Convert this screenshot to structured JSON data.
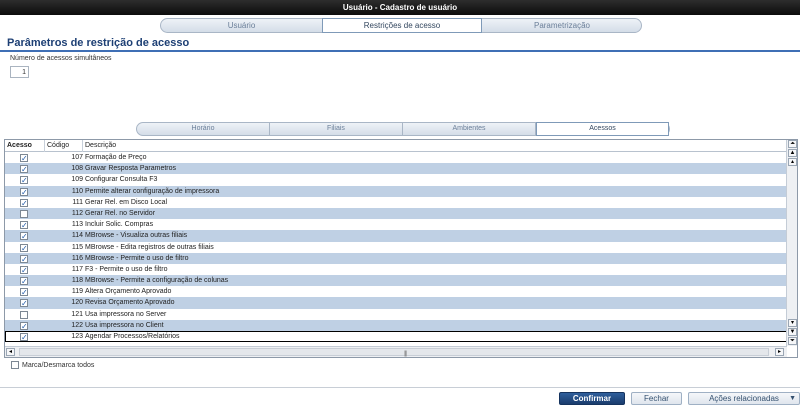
{
  "window": {
    "title": "Usuário - Cadastro de usuário"
  },
  "top_tabs": [
    {
      "label": "Usuário"
    },
    {
      "label": "Restrições de acesso"
    },
    {
      "label": "Parametrização"
    }
  ],
  "section": {
    "title": "Parâmetros de restrição de acesso"
  },
  "simultaneous": {
    "label": "Número de acessos simultâneos",
    "value": "1"
  },
  "mid_tabs": [
    {
      "label": "Horário"
    },
    {
      "label": "Filiais"
    },
    {
      "label": "Ambientes"
    },
    {
      "label": "Acessos"
    }
  ],
  "grid": {
    "columns": {
      "acesso": "Acesso",
      "codigo": "Código",
      "descricao": "Descrição"
    },
    "rows": [
      {
        "checked": true,
        "code": "107",
        "desc": "Formação de Preço"
      },
      {
        "checked": true,
        "code": "108",
        "desc": "Gravar Resposta Parametros"
      },
      {
        "checked": true,
        "code": "109",
        "desc": "Configurar Consulta F3"
      },
      {
        "checked": true,
        "code": "110",
        "desc": "Permite alterar configuração de impressora"
      },
      {
        "checked": true,
        "code": "111",
        "desc": "Gerar Rel. em Disco Local"
      },
      {
        "checked": false,
        "code": "112",
        "desc": "Gerar Rel. no Servidor"
      },
      {
        "checked": true,
        "code": "113",
        "desc": "Incluir Solic. Compras"
      },
      {
        "checked": true,
        "code": "114",
        "desc": "MBrowse - Visualiza outras filiais"
      },
      {
        "checked": true,
        "code": "115",
        "desc": "MBrowse - Edita registros de outras filiais"
      },
      {
        "checked": true,
        "code": "116",
        "desc": "MBrowse - Permite o uso de filtro"
      },
      {
        "checked": true,
        "code": "117",
        "desc": "F3 - Permite o uso de filtro"
      },
      {
        "checked": true,
        "code": "118",
        "desc": "MBrowse - Permite a configuração de colunas"
      },
      {
        "checked": true,
        "code": "119",
        "desc": "Altera Orçamento Aprovado"
      },
      {
        "checked": true,
        "code": "120",
        "desc": "Revisa Orçamento Aprovado"
      },
      {
        "checked": false,
        "code": "121",
        "desc": "Usa impressora no Server"
      },
      {
        "checked": true,
        "code": "122",
        "desc": "Usa impressora no Client"
      },
      {
        "checked": true,
        "code": "123",
        "desc": "Agendar Processos/Relatórios"
      }
    ]
  },
  "toggle_all": {
    "label": "Marca/Desmarca todos"
  },
  "footer": {
    "confirm": "Confirmar",
    "close": "Fechar",
    "actions": "Ações relacionadas"
  },
  "colors": {
    "accent": "#1d3f74",
    "row_alt": "#bfd0e4",
    "primary_button": "#1a3c6d"
  }
}
